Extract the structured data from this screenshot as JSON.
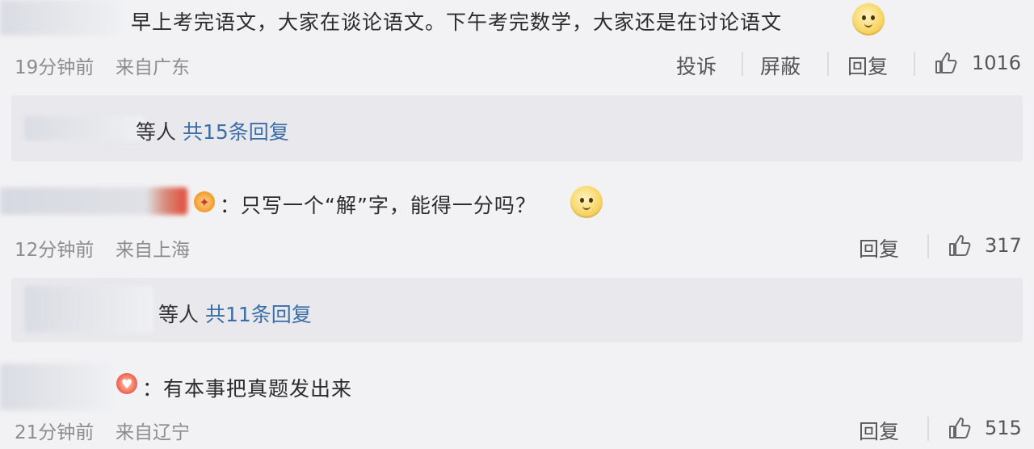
{
  "comments": [
    {
      "text": "早上考完语文，大家在谈论语文。下午考完数学，大家还是在讨论语文",
      "time": "19分钟前",
      "location": "来自广东",
      "actions": [
        "投诉",
        "屏蔽",
        "回复"
      ],
      "likes": "1016",
      "reply_summary": {
        "suffix": "等人",
        "link": "共15条回复"
      },
      "emoji": "doge-emoji"
    },
    {
      "separator": "：",
      "text": "只写一个“解”字，能得一分吗？",
      "time": "12分钟前",
      "location": "来自上海",
      "actions": [
        "回复"
      ],
      "likes": "317",
      "reply_summary": {
        "suffix": "等人",
        "link": "共11条回复"
      },
      "emoji": "doge-emoji"
    },
    {
      "separator": "：",
      "text": "有本事把真题发出来",
      "time": "21分钟前",
      "location": "来自辽宁",
      "actions": [
        "回复"
      ],
      "likes": "515"
    }
  ],
  "colors": {
    "link": "#3b6ea9",
    "meta": "#8c8c8c",
    "background": "#f2f2f4",
    "reply_box": "#e9e9ed"
  },
  "icons": [
    "thumbs-up-icon",
    "doge-emoji",
    "vip-badge-icon"
  ]
}
